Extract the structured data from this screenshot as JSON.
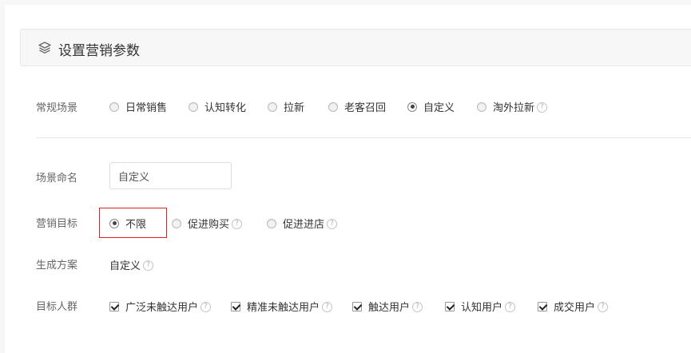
{
  "section": {
    "title": "设置营销参数",
    "icon": "layers-icon"
  },
  "scene": {
    "label": "常规场景",
    "options": [
      {
        "label": "日常销售",
        "checked": false,
        "help": false
      },
      {
        "label": "认知转化",
        "checked": false,
        "help": false
      },
      {
        "label": "拉新",
        "checked": false,
        "help": false
      },
      {
        "label": "老客召回",
        "checked": false,
        "help": false
      },
      {
        "label": "自定义",
        "checked": true,
        "help": false
      },
      {
        "label": "淘外拉新",
        "checked": false,
        "help": true
      }
    ]
  },
  "scene_name": {
    "label": "场景命名",
    "value": "自定义"
  },
  "goal": {
    "label": "营销目标",
    "options": [
      {
        "label": "不限",
        "checked": true,
        "help": false
      },
      {
        "label": "促进购买",
        "checked": false,
        "help": true
      },
      {
        "label": "促进进店",
        "checked": false,
        "help": true
      }
    ]
  },
  "plan": {
    "label": "生成方案",
    "value": "自定义"
  },
  "audience": {
    "label": "目标人群",
    "options": [
      {
        "label": "广泛未触达用户",
        "checked": true
      },
      {
        "label": "精准未触达用户",
        "checked": true
      },
      {
        "label": "触达用户",
        "checked": true
      },
      {
        "label": "认知用户",
        "checked": true
      },
      {
        "label": "成交用户",
        "checked": true
      }
    ]
  },
  "help_glyph": "?",
  "colors": {
    "highlight": "#e02020",
    "page_bg": "#f7f7f7"
  }
}
